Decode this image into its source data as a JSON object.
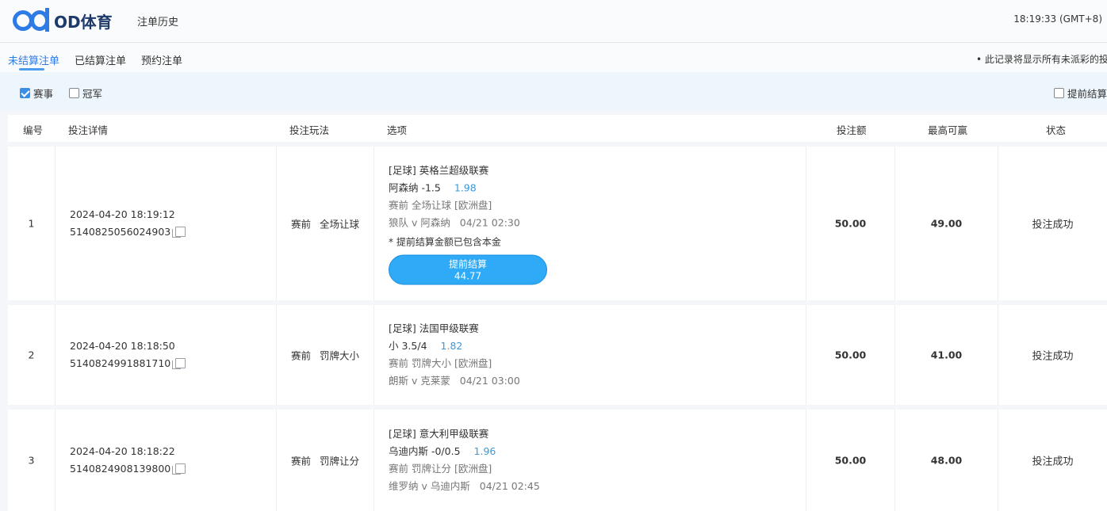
{
  "header": {
    "logo_text": "OD体育",
    "nav_history": "注单历史",
    "clock": "18:19:33 (GMT+8)"
  },
  "tabs": [
    {
      "label": "未结算注单",
      "active": true
    },
    {
      "label": "已结算注单",
      "active": false
    },
    {
      "label": "预约注单",
      "active": false
    }
  ],
  "notice": "• 此记录将显示所有未派彩的投",
  "filters": {
    "event": {
      "label": "赛事",
      "checked": true
    },
    "champion": {
      "label": "冠军",
      "checked": false
    },
    "early": {
      "label": "提前结算",
      "checked": false
    }
  },
  "columns": {
    "num": "编号",
    "detail": "投注详情",
    "play": "投注玩法",
    "option": "选项",
    "amount": "投注额",
    "maxwin": "最高可赢",
    "status": "状态"
  },
  "rows": [
    {
      "num": "1",
      "datetime": "2024-04-20 18:19:12",
      "id": "5140825056024903",
      "play_type": "赛前",
      "play_name": "全场让球",
      "league": "[足球] 英格兰超级联赛",
      "pick": "阿森纳 -1.5",
      "odds": "1.98",
      "market": "赛前 全场让球 [欧洲盘]",
      "match": "狼队 v 阿森纳",
      "match_time": "04/21 02:30",
      "note": "* 提前结算金额已包含本金",
      "early_label": "提前结算",
      "early_value": "44.77",
      "amount": "50.00",
      "maxwin": "49.00",
      "status": "投注成功"
    },
    {
      "num": "2",
      "datetime": "2024-04-20 18:18:50",
      "id": "5140824991881710",
      "play_type": "赛前",
      "play_name": "罚牌大小",
      "league": "[足球] 法国甲级联赛",
      "pick": "小 3.5/4",
      "odds": "1.82",
      "market": "赛前 罚牌大小 [欧洲盘]",
      "match": "朗斯 v 克莱蒙",
      "match_time": "04/21 03:00",
      "amount": "50.00",
      "maxwin": "41.00",
      "status": "投注成功"
    },
    {
      "num": "3",
      "datetime": "2024-04-20 18:18:22",
      "id": "5140824908139800",
      "play_type": "赛前",
      "play_name": "罚牌让分",
      "league": "[足球] 意大利甲级联赛",
      "pick": "乌迪内斯 -0/0.5",
      "odds": "1.96",
      "market": "赛前 罚牌让分 [欧洲盘]",
      "match": "维罗纳 v 乌迪内斯",
      "match_time": "04/21 02:45",
      "amount": "50.00",
      "maxwin": "48.00",
      "status": "投注成功"
    }
  ],
  "colors": {
    "accent": "#2f7be5",
    "odds": "#3a9ad9",
    "button": "#2eaaf7",
    "filter_bg": "#eef6fd"
  }
}
